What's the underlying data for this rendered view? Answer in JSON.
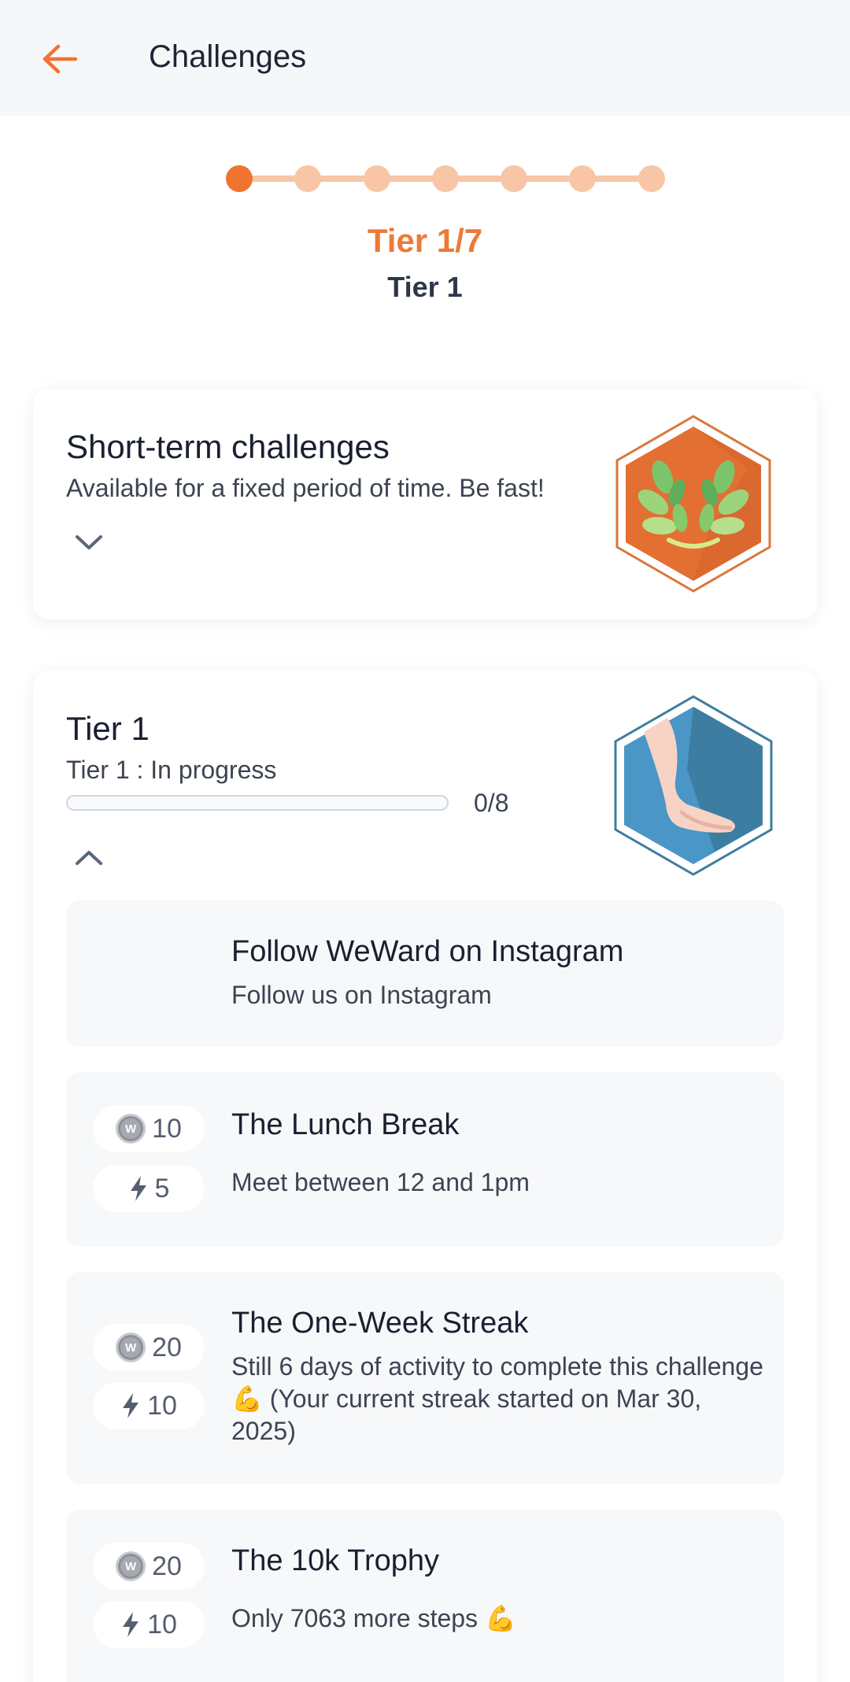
{
  "header": {
    "title": "Challenges",
    "back_icon": "arrow-left-icon",
    "accent": "#f07330"
  },
  "tier_progress": {
    "steps_total": 7,
    "current_step": 1,
    "count_label": "Tier 1/7",
    "name": "Tier 1"
  },
  "short_term": {
    "title": "Short-term challenges",
    "subtitle": "Available for a fixed period of time. Be fast!",
    "expand_icon": "chevron-down-icon",
    "badge_icon": "laurel-badge-icon"
  },
  "tier_card": {
    "title": "Tier 1",
    "status": "Tier 1 : In progress",
    "progress_text": "0/8",
    "progress_fraction": 0,
    "collapse_icon": "chevron-up-icon",
    "badge_icon": "foot-badge-icon",
    "challenges": [
      {
        "title": "Follow WeWard on Instagram",
        "description": "Follow us on Instagram"
      },
      {
        "title": "The Lunch Break",
        "description": "Meet between 12 and 1pm",
        "coins": "10",
        "energy": "5"
      },
      {
        "title": "The One-Week Streak",
        "description": "Still 6 days of activity to complete this challenge 💪 (Your current streak started on Mar 30, 2025)",
        "coins": "20",
        "energy": "10"
      },
      {
        "title": "The 10k Trophy",
        "description": "Only 7063 more steps 💪",
        "coins": "20",
        "energy": "10"
      }
    ]
  }
}
